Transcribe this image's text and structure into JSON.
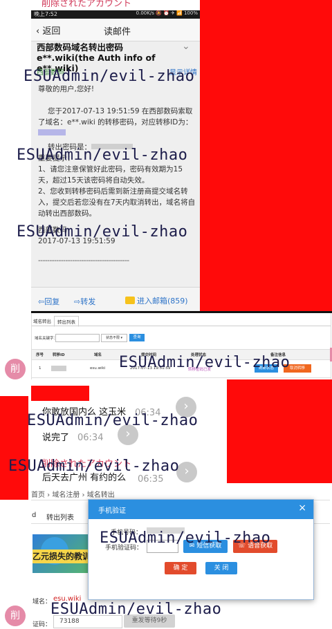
{
  "top_caption": "削除されたアカウント",
  "status_bar": {
    "time": "晚上7:52",
    "right": "0.00K/s 🔕 ⏰ ✈ 📶 100%"
  },
  "nav": {
    "back": "返回",
    "title": "读邮件"
  },
  "mail": {
    "subject": "西部数码域名转出密码e**.wiki(the Auth info of e**.wiki)",
    "sender": "西部数码",
    "details_link": "显示详情",
    "greeting": "尊敬的用户,您好!",
    "para1": "您于2017-07-13 19:51:59 在西部数码索取了域名：e**.wiki 的转移密码，对应转移ID为：",
    "transfer_code_label": "转出密码是：",
    "notice_title": "重要提示：",
    "notice1": "1、请您注意保管好此密码，密码有效期为15天，超过15天该密码将自动失效。",
    "notice2": "2、您收到转移密码后需到新注册商提交域名转入，提交后若您没有在7天内取消转出，域名将自动转出西部数码。",
    "sign_company": "西部数码",
    "sign_date": "2017-07-13 19:51:59",
    "divider": "----------------------------------------"
  },
  "mail_toolbar": {
    "reply": "回复",
    "forward": "转发",
    "inbox": "进入邮箱(859)"
  },
  "panel1": {
    "tabs": [
      "域名转出",
      "转出列表"
    ],
    "filter_label": "域名关键字：",
    "filter_status": "状态不限 ▾",
    "query": "查询",
    "headers": [
      "序号",
      "转移ID",
      "域名",
      "提交时间",
      "处理状态",
      "备注信息"
    ],
    "row": {
      "no": "1",
      "domain": "esu.wiki",
      "time": "2017-07-13 19:51:59",
      "status": "转移密码已发",
      "refresh": "刷新状态",
      "cancel": "取消转移"
    }
  },
  "avatar_label": "削",
  "chat": [
    {
      "text": "你敢放国内么 这玉米",
      "time": "06:34"
    },
    {
      "text": "说完了",
      "time": "06:34"
    },
    {
      "text": "后天去广州 有约的么",
      "time": "06:35"
    }
  ],
  "chat_caption": "削除されたアカウント",
  "panel2": {
    "breadcrumb": "首页 › 域名注册 › 域名转出",
    "tab_prefix": "d",
    "tab": "转出列表",
    "banner_text": "乙元损失的教训",
    "dialog": {
      "title": "手机验证",
      "close": "×",
      "phone_label": "手机号码：",
      "code_label": "手机验证码：",
      "sms_btn": "短信获取",
      "voice_btn": "语音获取",
      "confirm": "确 定",
      "close_btn": "关 闭"
    },
    "domain_label": "域名：",
    "domain_value": "esu.wiki",
    "code_label": "证码：",
    "code_value": "73188",
    "resend": "重发等待9秒"
  },
  "watermark": "ESUAdmin/evil-zhao",
  "colors": {
    "redact": "#ff0a0a",
    "accent": "#2b8fe0",
    "link": "#2d73c8"
  }
}
